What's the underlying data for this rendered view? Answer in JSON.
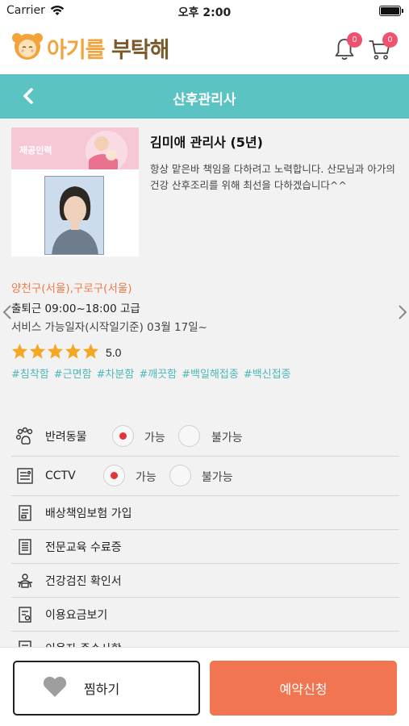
{
  "status_bar": {
    "carrier": "Carrier",
    "time": "오후 2:00"
  },
  "app_header": {
    "logo_part1": "아기를",
    "logo_part2": "부탁해",
    "notification_count": "0",
    "cart_count": "0"
  },
  "nav": {
    "title": "산후관리사"
  },
  "profile": {
    "banner_text": "제공인력",
    "name": "김미애 관리사 (5년)",
    "intro": "항상 맡은바 책임을 다하려고 노력합니다. 산모님과 아가의 건강 산후조리를 위해 최선을 다하겠습니다^^",
    "region": "양천구(서울),구로구(서울)",
    "hours": "출퇴근 09:00~18:00 고급",
    "available": "서비스 가능일자(시작일기준) 03월 17일~",
    "rating_stars": 5,
    "rating_score": "5.0",
    "tags": [
      "#침착함",
      "#근면함",
      "#차분함",
      "#깨끗함",
      "#백일해접종",
      "#백신접종"
    ]
  },
  "options": {
    "pet": {
      "label": "반려동물",
      "yes": "가능",
      "no": "불가능",
      "selected": "가능"
    },
    "cctv": {
      "label": "CCTV",
      "yes": "가능",
      "no": "불가능",
      "selected": "가능"
    },
    "items": [
      {
        "label": "배상책임보험 가입",
        "icon": "insurance-doc-icon"
      },
      {
        "label": "전문교육 수료증",
        "icon": "certificate-icon"
      },
      {
        "label": "건강검진 확인서",
        "icon": "health-check-icon"
      },
      {
        "label": "이용요금보기",
        "icon": "price-list-icon"
      },
      {
        "label": "이용자 준수사항",
        "icon": "rules-icon"
      }
    ]
  },
  "bottom_bar": {
    "wish_label": "찜하기",
    "reserve_label": "예약신청"
  },
  "colors": {
    "primary_teal": "#5cc3c3",
    "accent_orange": "#f27552",
    "logo_orange": "#f2a33a",
    "badge_pink": "#f0516e",
    "star_yellow": "#f5a623",
    "tag_teal": "#4db8b8",
    "region_orange": "#f07a4a",
    "radio_red": "#e2343a"
  }
}
